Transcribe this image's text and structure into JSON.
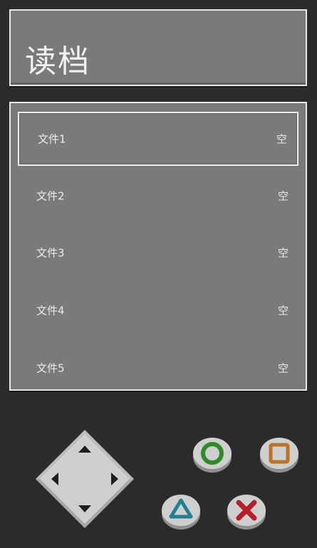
{
  "header": {
    "title": "读档"
  },
  "slots": [
    {
      "label": "文件1",
      "status": "空",
      "selected": true
    },
    {
      "label": "文件2",
      "status": "空",
      "selected": false
    },
    {
      "label": "文件3",
      "status": "空",
      "selected": false
    },
    {
      "label": "文件4",
      "status": "空",
      "selected": false
    },
    {
      "label": "文件5",
      "status": "空",
      "selected": false
    }
  ],
  "controls": {
    "dpad_icon": "dpad-icon",
    "circle_icon": "circle-icon",
    "square_icon": "square-icon",
    "triangle_icon": "triangle-icon",
    "cross_icon": "cross-icon"
  },
  "colors": {
    "background": "#2b2b2b",
    "panel": "#7a7a7a",
    "panel_border": "#e8e8e8",
    "circle_color": "#2f8a2a",
    "square_color": "#b8742a",
    "triangle_color": "#1f7f93",
    "cross_color": "#b41f2a"
  }
}
